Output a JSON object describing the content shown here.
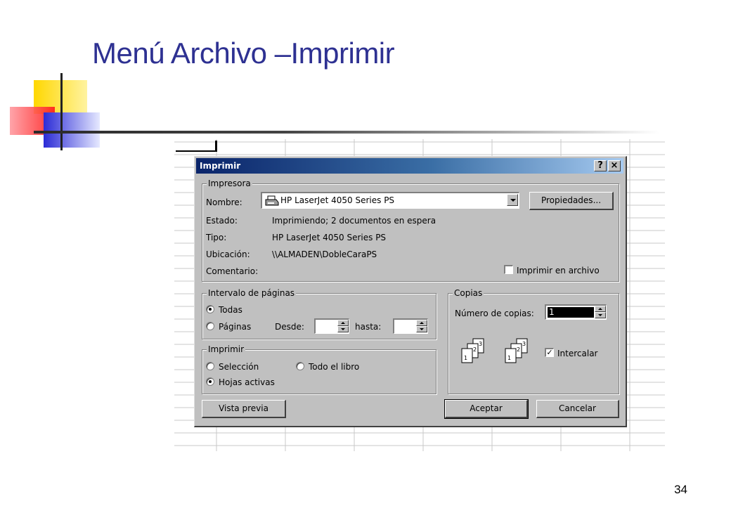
{
  "slide": {
    "title": "Menú Archivo –Imprimir",
    "page_number": "34"
  },
  "dialog": {
    "title": "Imprimir",
    "help_button": "?",
    "close_button": "×",
    "printer": {
      "legend": "Impresora",
      "name_label": "Nombre:",
      "name_value": "HP LaserJet 4050 Series PS",
      "properties_button": "Propiedades...",
      "status_label": "Estado:",
      "status_value": "Imprimiendo; 2 documentos en espera",
      "type_label": "Tipo:",
      "type_value": "HP LaserJet 4050 Series PS",
      "location_label": "Ubicación:",
      "location_value": "\\\\ALMADEN\\DobleCaraPS",
      "comment_label": "Comentario:",
      "print_to_file_label": "Imprimir en archivo",
      "print_to_file_checked": false
    },
    "range": {
      "legend": "Intervalo de páginas",
      "all_label": "Todas",
      "pages_label": "Páginas",
      "from_label": "Desde:",
      "to_label": "hasta:",
      "from_value": "",
      "to_value": "",
      "selected": "all"
    },
    "print_what": {
      "legend": "Imprimir",
      "selection_label": "Selección",
      "workbook_label": "Todo el libro",
      "active_sheets_label": "Hojas activas",
      "selected": "active_sheets"
    },
    "copies": {
      "legend": "Copias",
      "number_label": "Número de copias:",
      "number_value": "1",
      "collate_label": "Intercalar",
      "collate_checked": true
    },
    "buttons": {
      "preview": "Vista previa",
      "ok": "Aceptar",
      "cancel": "Cancelar"
    }
  },
  "colors": {
    "title_blue": "#2e3192",
    "dialog_gray": "#c0c0c0",
    "titlebar_start": "#0a246a",
    "titlebar_end": "#a6caf0"
  },
  "icons": [
    "printer-icon",
    "collate-pages-icon",
    "help-icon",
    "close-icon"
  ]
}
